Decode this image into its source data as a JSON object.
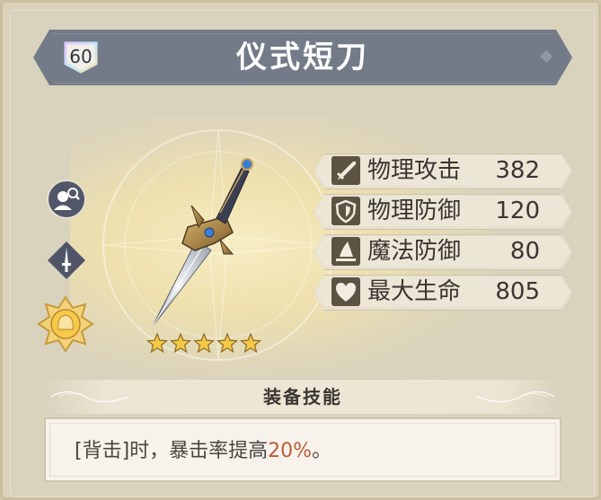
{
  "item": {
    "level": "60",
    "name": "仪式短刀",
    "stars": 5
  },
  "side_icons": {
    "inspect": "inspect-figure-icon",
    "weapon_type": "dagger-type-icon",
    "emblem": "gold-flower-emblem-icon"
  },
  "stats": [
    {
      "icon": "sword-icon",
      "label": "物理攻击",
      "value": "382"
    },
    {
      "icon": "shield-icon",
      "label": "物理防御",
      "value": "120"
    },
    {
      "icon": "wizard-hat-icon",
      "label": "魔法防御",
      "value": "80"
    },
    {
      "icon": "heart-icon",
      "label": "最大生命",
      "value": "805"
    }
  ],
  "skill": {
    "header": "装备技能",
    "text_prefix": "[背击]时，暴击率提高",
    "highlight": "20%",
    "text_suffix": "。"
  },
  "colors": {
    "title_bar": "#737b88",
    "highlight": "#c05a3a",
    "stat_icon_bg": "#5d5343",
    "star": "#f4c945"
  }
}
